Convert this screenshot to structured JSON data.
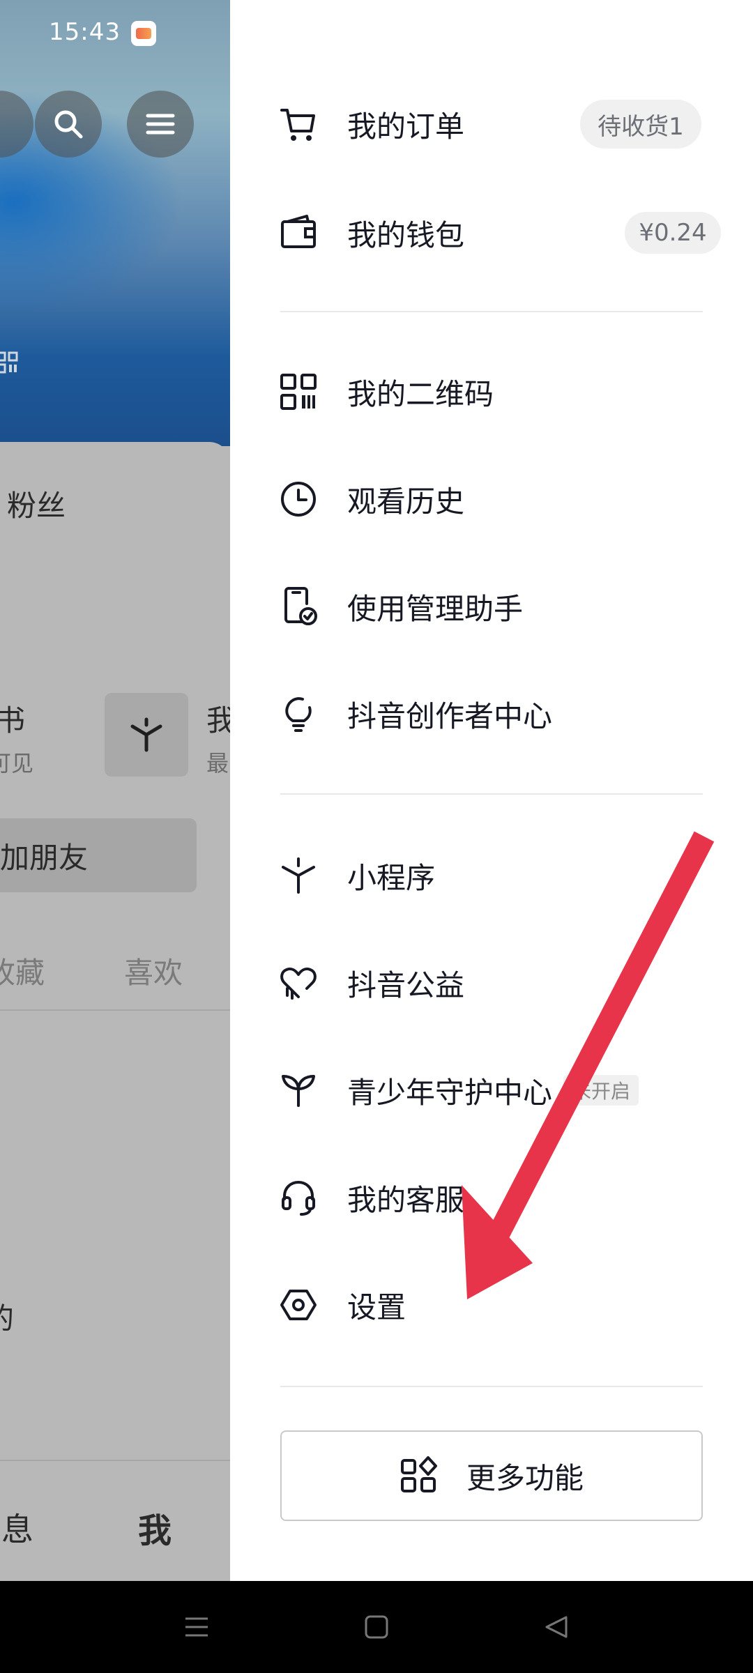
{
  "status_bar": {
    "time": "15:43"
  },
  "left_page": {
    "fans_label": "粉丝",
    "shu_text": "书",
    "shu_sub": "可见",
    "wo_text": "我",
    "zui_text": "最",
    "add_friend": "加朋友",
    "tab_collect": "收藏",
    "tab_like": "喜欢",
    "de_text": "的",
    "nav_msg": "消息",
    "nav_me": "我"
  },
  "drawer": {
    "group1": [
      {
        "label": "我的订单",
        "icon": "cart-icon",
        "badge": "待收货1"
      },
      {
        "label": "我的钱包",
        "icon": "wallet-icon",
        "badge": "¥0.24"
      }
    ],
    "group2": [
      {
        "label": "我的二维码",
        "icon": "qrcode-icon"
      },
      {
        "label": "观看历史",
        "icon": "clock-icon"
      },
      {
        "label": "使用管理助手",
        "icon": "phone-check-icon"
      },
      {
        "label": "抖音创作者中心",
        "icon": "lightbulb-icon"
      }
    ],
    "group3": [
      {
        "label": "小程序",
        "icon": "miniprogram-icon"
      },
      {
        "label": "抖音公益",
        "icon": "charity-heart-icon"
      },
      {
        "label": "青少年守护中心",
        "icon": "sprout-icon",
        "tag": "未开启"
      },
      {
        "label": "我的客服",
        "icon": "headset-icon"
      },
      {
        "label": "设置",
        "icon": "settings-hexagon-icon"
      }
    ],
    "more_button": "更多功能"
  },
  "colors": {
    "accent_arrow": "#E8344A",
    "text": "#161823",
    "badge_bg": "#F0F0F0"
  }
}
